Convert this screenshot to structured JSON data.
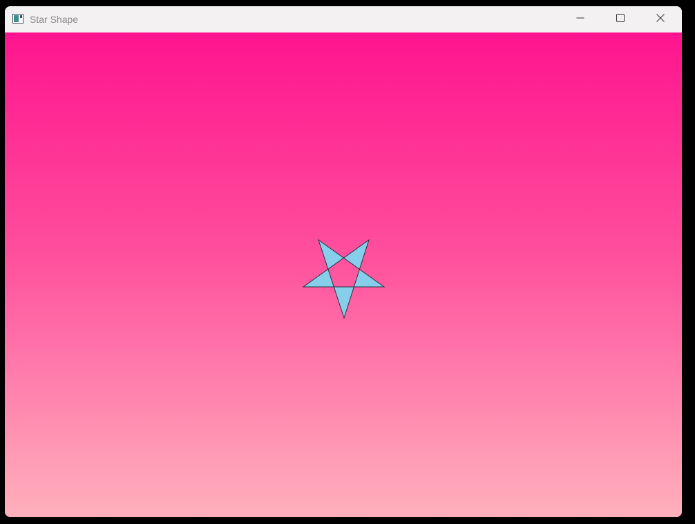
{
  "window": {
    "title": "Star Shape",
    "icon": "window-app-icon",
    "controls": {
      "minimize_icon": "minimize-icon",
      "maximize_icon": "maximize-icon",
      "close_icon": "close-icon"
    }
  },
  "canvas": {
    "background_top_color": "#ff148f",
    "background_bottom_color": "#ffb0bb",
    "shape": {
      "type": "five-pointed-star",
      "fill_color": "#87ceeb",
      "stroke_color": "#1f3340"
    }
  }
}
